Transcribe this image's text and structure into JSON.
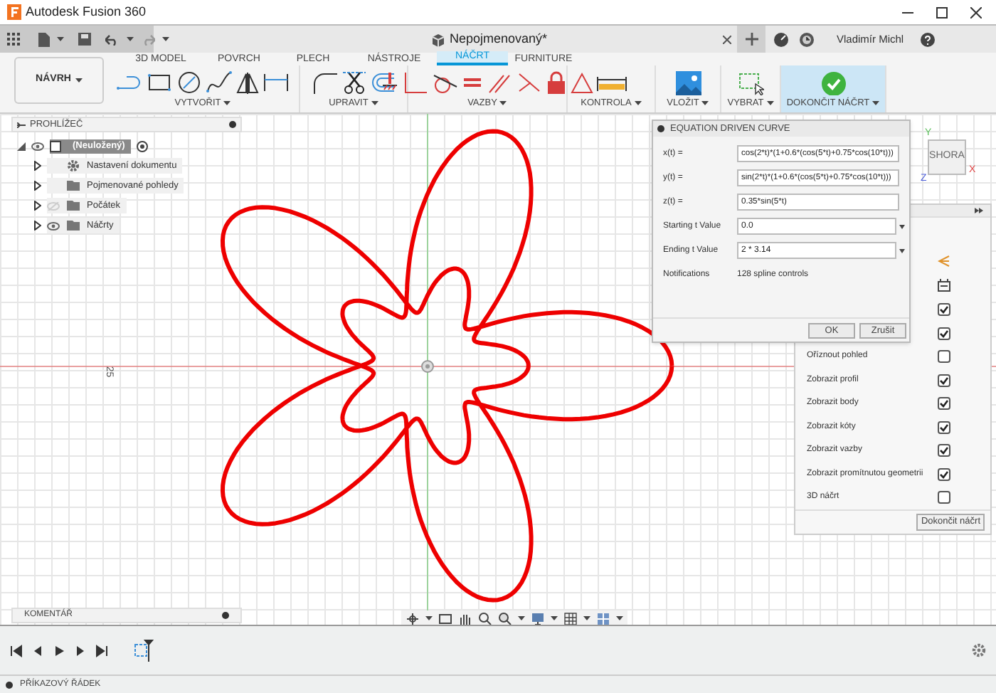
{
  "window": {
    "title": "Autodesk Fusion 360",
    "document_tab": "Nepojmenovaný*",
    "user": "Vladimír Michl"
  },
  "workspace": {
    "label": "NÁVRH"
  },
  "tabs": [
    {
      "label": "3D MODEL",
      "selected": false
    },
    {
      "label": "POVRCH",
      "selected": false
    },
    {
      "label": "PLECH",
      "selected": false
    },
    {
      "label": "NÁSTROJE",
      "selected": false
    },
    {
      "label": "NÁČRT",
      "selected": true
    },
    {
      "label": "FURNITURE",
      "selected": false
    }
  ],
  "groups": [
    {
      "label": "VYTVOŘIT"
    },
    {
      "label": "UPRAVIT"
    },
    {
      "label": "VAZBY"
    },
    {
      "label": "KONTROLA"
    },
    {
      "label": "VLOŽIT"
    },
    {
      "label": "VYBRAT"
    },
    {
      "label": "DOKONČIT NÁČRT",
      "selected": true
    }
  ],
  "browser": {
    "title": "PROHLÍŽEČ",
    "root": {
      "label": "(Neuložený)",
      "children": [
        {
          "label": "Nastavení dokumentu",
          "kind": "settings"
        },
        {
          "label": "Pojmenované pohledy",
          "kind": "folder"
        },
        {
          "label": "Počátek",
          "kind": "folder",
          "visible": false
        },
        {
          "label": "Náčrty",
          "kind": "folder",
          "visible": true
        }
      ]
    }
  },
  "comments": {
    "title": "KOMENTÁŘ"
  },
  "canvas": {
    "ruler_label": "25",
    "viewcube": {
      "face": "SHORA",
      "axes": [
        "Y",
        "Z",
        "X"
      ]
    }
  },
  "dialog": {
    "title": "EQUATION DRIVEN CURVE",
    "rows": [
      {
        "label": "x(t) =",
        "kind": "field",
        "value": "cos(2*t)*(1+0.6*(cos(5*t)+0.75*cos(10*t)))"
      },
      {
        "label": "y(t) =",
        "kind": "field",
        "value": "sin(2*t)*(1+0.6*(cos(5*t)+0.75*cos(10*t)))"
      },
      {
        "label": "z(t) =",
        "kind": "field",
        "value": "0.35*sin(5*t)"
      },
      {
        "label": "Starting t Value",
        "kind": "dropdown",
        "value": "0.0"
      },
      {
        "label": "Ending t Value",
        "kind": "dropdown",
        "value": "2 * 3.14"
      },
      {
        "label": "Notifications",
        "kind": "text",
        "value": "128 spline controls"
      }
    ],
    "buttons": [
      "OK",
      "Zrušit"
    ]
  },
  "palette": {
    "rows": [
      {
        "checked": true
      },
      {
        "checked": true
      },
      {
        "label": "Oříznout pohled",
        "checked": false
      },
      {
        "label": "Zobrazit profil",
        "checked": true
      },
      {
        "label": "Zobrazit body",
        "checked": true
      },
      {
        "label": "Zobrazit kóty",
        "checked": true
      },
      {
        "label": "Zobrazit vazby",
        "checked": true
      },
      {
        "label": "Zobrazit promítnutou geometrii",
        "checked": true
      },
      {
        "label": "3D náčrt",
        "checked": false
      }
    ],
    "button": "Dokončit náčrt"
  },
  "command_line": {
    "label": "PŘÍKAZOVÝ ŘÁDEK"
  }
}
